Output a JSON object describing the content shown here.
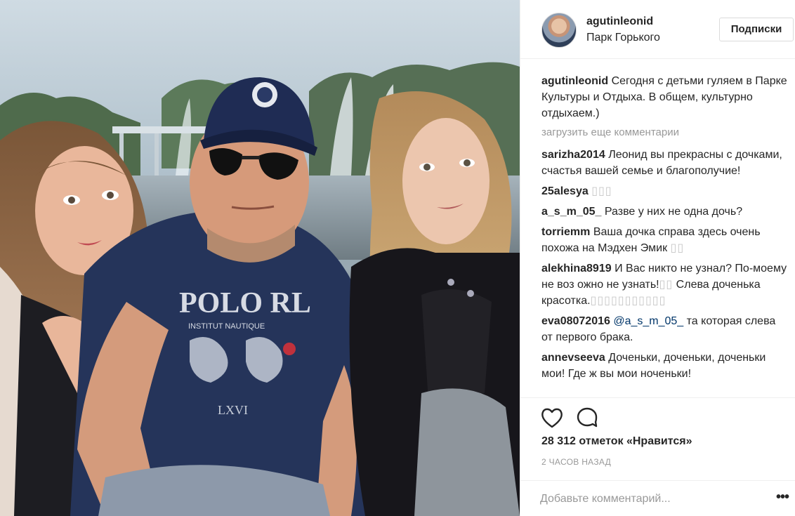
{
  "header": {
    "username": "agutinleonid",
    "location": "Парк Горького",
    "follow_label": "Подписки"
  },
  "caption": {
    "user": "agutinleonid",
    "text": "Сегодня с детьми гуляем в Парке Культуры и Отдыха. В общем, культурно отдыхаем.)"
  },
  "load_more_label": "загрузить еще комментарии",
  "comments": [
    {
      "user": "sarizha2014",
      "text": "Леонид вы прекрасны с дочками, счастья вашей семье и благополучие!"
    },
    {
      "user": "25alesya",
      "text": "",
      "boxes": "▯▯▯"
    },
    {
      "user": "a_s_m_05_",
      "text": "Разве у них не одна дочь?"
    },
    {
      "user": "torriemm",
      "text": "Ваша дочка справа здесь очень похожа на Мэдхен Эмик",
      "boxes": "▯▯"
    },
    {
      "user": "alekhina8919",
      "text": "И Вас никто не узнал? По-моему не воз ожно не узнать!",
      "boxes_mid": "▯▯",
      "text2": "Слева доченька красотка.",
      "boxes": "▯▯▯▯▯▯▯▯▯▯▯"
    },
    {
      "user": "eva08072016",
      "mention": "@a_s_m_05_",
      "text": "та которая слева от первого брака."
    },
    {
      "user": "annevseeva",
      "text": "Доченьки, доченьки, доченьки мои! Где ж вы мои ноченьки!"
    }
  ],
  "actions": {
    "like_icon": "heart-icon",
    "comment_icon": "comment-icon",
    "likes_text": "28 312 отметок «Нравится»",
    "time_text": "2 ЧАСОВ НАЗАД"
  },
  "add_comment": {
    "placeholder": "Добавьте комментарий...",
    "more_icon": "more-icon"
  },
  "photo": {
    "cap_text": "",
    "shirt_text_1": "POLO RL",
    "shirt_text_2": "INSTITUT NAUTIQUE",
    "shirt_text_3": "LXVI"
  },
  "colors": {
    "text": "#262626",
    "muted": "#999999",
    "mention": "#003569",
    "border": "#efefef"
  }
}
